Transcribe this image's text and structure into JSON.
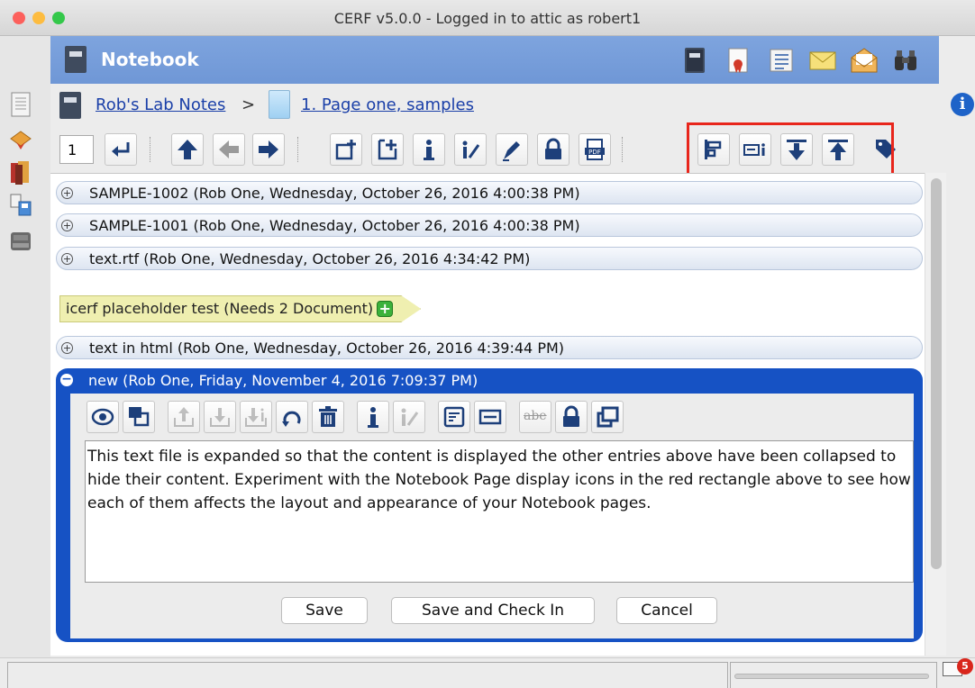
{
  "window": {
    "title": "CERF v5.0.0 - Logged in to attic as robert1",
    "traffic_lights": [
      "#fc605c",
      "#fdbc40",
      "#34c84a"
    ]
  },
  "header": {
    "title": "Notebook",
    "icons": [
      "notebook-icon",
      "certificate-icon",
      "list-icon",
      "mail-icon",
      "open-mail-icon",
      "binoculars-icon"
    ]
  },
  "breadcrumb": {
    "notebook": "Rob's Lab Notes",
    "separator": ">",
    "page": "1. Page one, samples"
  },
  "toolbar": {
    "page_number": "1",
    "highlight_color": "#e8261c"
  },
  "entries": [
    {
      "label": "SAMPLE-1002 (Rob One, Wednesday, October 26, 2016 4:00:38 PM)"
    },
    {
      "label": "SAMPLE-1001 (Rob One, Wednesday, October 26, 2016 4:00:38 PM)"
    },
    {
      "label": "text.rtf (Rob One, Wednesday, October 26, 2016 4:34:42 PM)"
    }
  ],
  "placeholder": {
    "label": "icerf placeholder test (Needs 2 Document)",
    "add": "+"
  },
  "entry_html": {
    "label": "text in html (Rob One, Wednesday, October 26, 2016 4:39:44 PM)"
  },
  "open_entry": {
    "label": "new  (Rob One, Friday, November 4, 2016 7:09:37 PM)",
    "text": "This text file is expanded so that the content is displayed the other entries above have been collapsed to hide their content. Experiment with the Notebook Page display icons in the red rectangle above to see how each of them affects the layout and appearance of your Notebook pages.",
    "strike_label": "abe",
    "buttons": {
      "save": "Save",
      "save_checkin": "Save and Check In",
      "cancel": "Cancel"
    },
    "accent": "#1652c4"
  },
  "info_label": "i",
  "status": {
    "mail_count": "5"
  }
}
